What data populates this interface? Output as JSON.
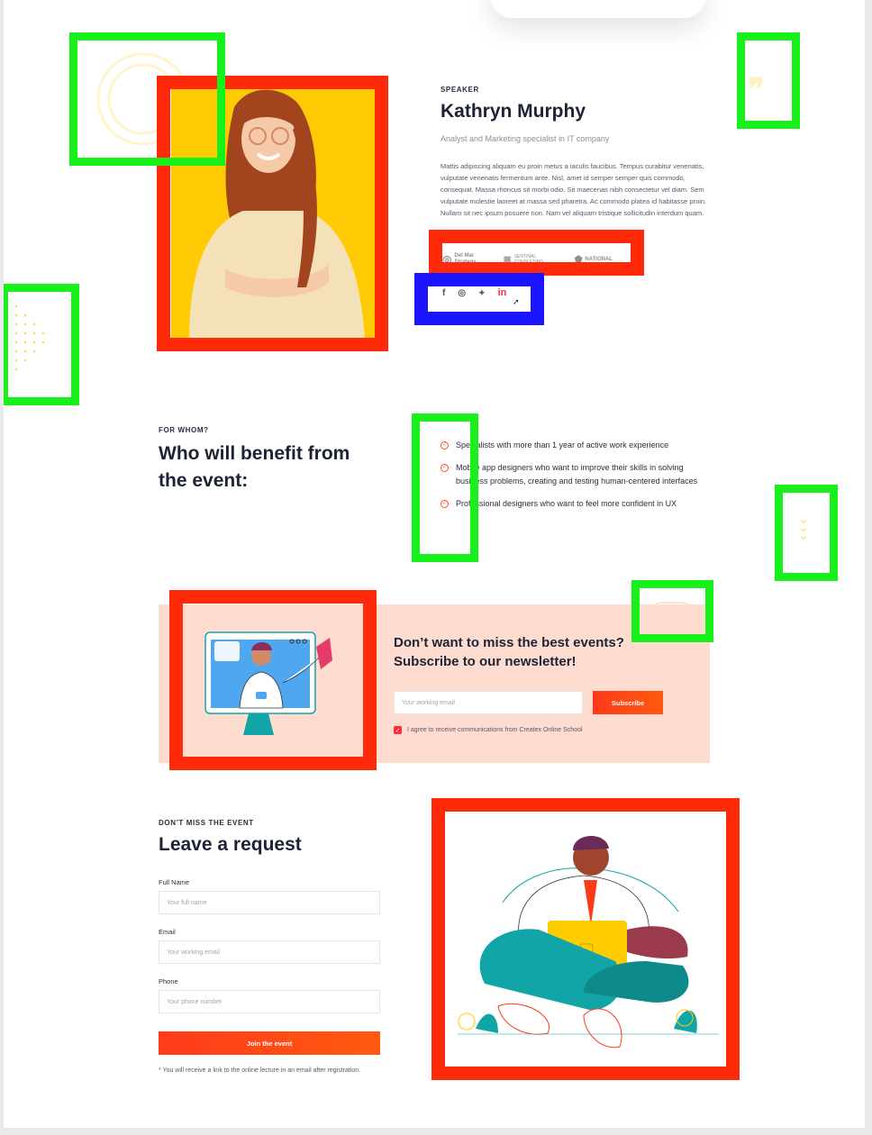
{
  "speaker": {
    "eyebrow": "SPEAKER",
    "name": "Kathryn Murphy",
    "role": "Analyst and Marketing specialist in IT company",
    "bio": "Mattis adipiscing aliquam eu proin metus a iaculis faucibus. Tempus curabitur venenatis, vulputate venenatis fermentum ante. Nisl, amet id semper semper quis commodo, consequat. Massa rhoncus sit morbi odio. Sit maecenas nibh consectetur vel diam. Sem vulputate molestie laoreet at massa sed pharetra. Ac commodo platea id habitasse proin. Nullam sit nec ipsum posuere non. Nam vel aliquam tristique sollicitudin interdum quam.",
    "logos": [
      {
        "name": "Del Mar Strategy",
        "icon": "swirl-logo-icon"
      },
      {
        "name": "SENTINAL CONSULTING",
        "icon": "stack-logo-icon"
      },
      {
        "name": "NATIONAL",
        "icon": "shield-logo-icon"
      }
    ],
    "social": [
      {
        "label": "f",
        "icon": "facebook-icon"
      },
      {
        "label": "◎",
        "icon": "instagram-icon"
      },
      {
        "label": "🐦",
        "icon": "twitter-icon"
      },
      {
        "label": "in",
        "icon": "linkedin-icon"
      }
    ]
  },
  "for_whom": {
    "eyebrow": "FOR WHOM?",
    "title_line1": "Who will benefit from",
    "title_line2": "the event:",
    "items": [
      "Specialists with more than 1 year of active work experience",
      "Mobile app designers who want to improve their skills in solving business problems, creating and testing human-centered interfaces",
      "Professional designers who want to feel more confident in UX"
    ]
  },
  "newsletter": {
    "title_line1": "Don’t want to miss the best events?",
    "title_line2": "Subscribe to our newsletter!",
    "email_placeholder": "Your working email",
    "subscribe_label": "Subscribe",
    "consent": "I agree to receive communications from Createx Online School"
  },
  "request": {
    "eyebrow": "DON’T MISS THE EVENT",
    "title": "Leave a request",
    "fullname_label": "Full Name",
    "fullname_placeholder": "Your full name",
    "email_label": "Email",
    "email_placeholder": "Your working email",
    "phone_label": "Phone",
    "phone_placeholder": "Your phone number",
    "submit_label": "Join the event",
    "note": "* You will receive a link to the online lecture in an email after registration."
  },
  "colors": {
    "highlight_red": "#ff2a0a",
    "highlight_green": "#18f01c",
    "highlight_blue": "#1c14ff",
    "accent": "#ff3a1a",
    "portrait_bg": "#ffcb05",
    "newsletter_bg": "#ffdcd0"
  }
}
